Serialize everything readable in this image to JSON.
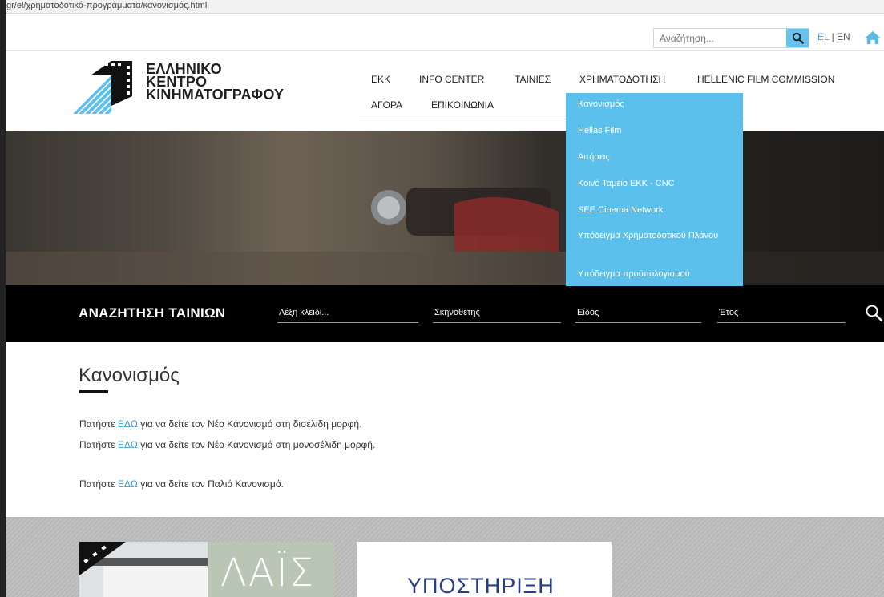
{
  "browser": {
    "url": "gr/el/χρηματοδοτικά-προγράμματα/κανονισμός.html"
  },
  "topbar": {
    "search_placeholder": "Αναζήτηση...",
    "lang_el": "EL",
    "lang_sep": " | ",
    "lang_en": "EN"
  },
  "logo": {
    "line1": "ΕΛΛΗΝΙΚΟ",
    "line2": "ΚΕΝΤΡΟ",
    "line3": "ΚΙΝΗΜΑΤΟΓΡΑΦΟΥ"
  },
  "nav": {
    "items": [
      "ΕΚΚ",
      "INFO CENTER",
      "ΤΑΙΝΙΕΣ",
      "ΧΡΗΜΑΤΟΔΟΤΗΣΗ",
      "HELLENIC FILM COMMISSION",
      "ΑΓΟΡΑ",
      "ΕΠΙΚΟΙΝΩΝΙΑ"
    ]
  },
  "dropdown": {
    "items": [
      "Κανονισμός",
      "Hellas Film",
      "Αιτήσεις",
      "Κοινό Ταμείο ΕΚΚ - CNC",
      "SEE Cinema Network",
      "Υπόδειγμα Χρηματοδοτικού Πλάνου",
      "Υπόδειγμα προϋπολογισμού"
    ]
  },
  "film_search": {
    "title": "ΑΝΑΖΗΤΗΣΗ ΤΑΙΝΙΩΝ",
    "keyword": "Λέξη κλειδί...",
    "director": "Σκηνοθέτης",
    "genre": "Είδος",
    "year": "Έτος"
  },
  "content": {
    "title": "Κανονισμός",
    "paragraphs": [
      {
        "pre": "Πατήστε ",
        "link": "ΕΔΩ",
        "post": " για να δείτε τον Νέο Κανονισμό στη δισέλιδη μορφή."
      },
      {
        "pre": "Πατήστε ",
        "link": "ΕΔΩ",
        "post": " για να δείτε τον Νέο Κανονισμό στη μονοσέλιδη μορφή."
      },
      {
        "pre": "Πατήστε ",
        "link": "ΕΔΩ",
        "post": " για να δείτε τον Παλιό Κανονισμό."
      }
    ]
  },
  "cards": {
    "card1_text": "ΛΑΪΣ",
    "card2_text": "ΥΠΟΣΤΗΡΙΞΗ"
  },
  "colors": {
    "accent": "#5bc0ec",
    "link": "#3a9bd6",
    "film_bar": "#000000"
  }
}
